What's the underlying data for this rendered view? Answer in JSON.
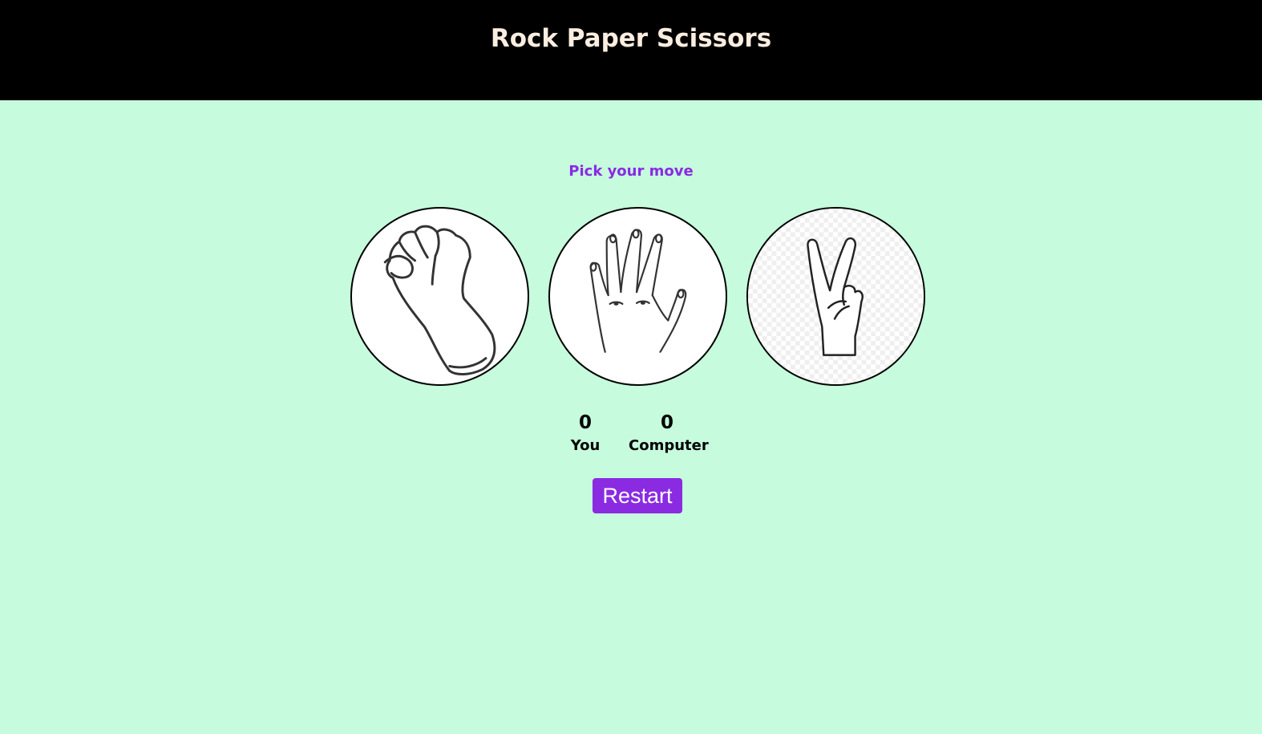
{
  "header": {
    "title": "Rock Paper Scissors"
  },
  "prompt": "Pick your move",
  "choices": [
    {
      "name": "rock",
      "icon": "fist-icon"
    },
    {
      "name": "paper",
      "icon": "open-hand-icon"
    },
    {
      "name": "scissors",
      "icon": "peace-sign-icon"
    }
  ],
  "score": {
    "user": {
      "value": "0",
      "label": "You"
    },
    "computer": {
      "value": "0",
      "label": "Computer"
    }
  },
  "restart_label": "Restart",
  "colors": {
    "header_bg": "#000000",
    "header_text": "#fbeee0",
    "page_bg": "#c6fcdd",
    "accent": "#8a2be2"
  }
}
